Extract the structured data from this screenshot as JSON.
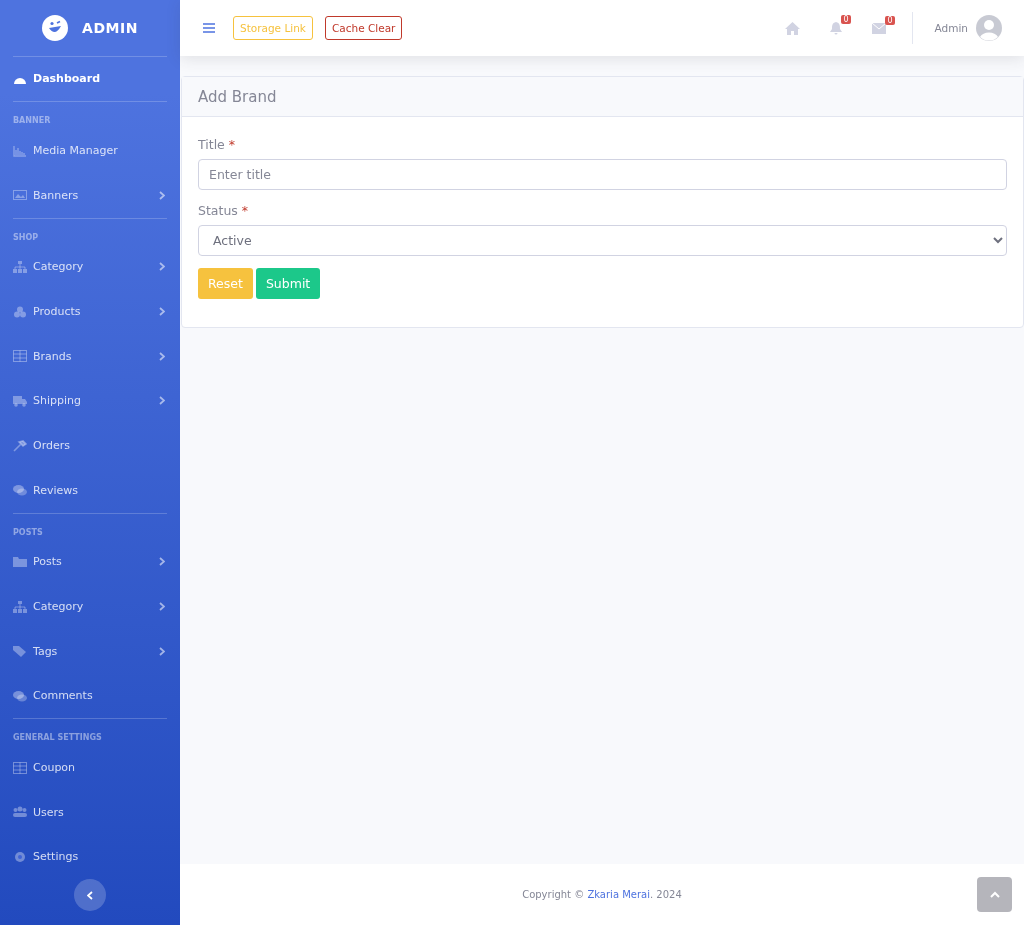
{
  "brand": {
    "title": "ADMIN"
  },
  "sidebar": {
    "sections": [
      {
        "items": [
          {
            "label": "Dashboard",
            "selected": true,
            "expandable": false
          }
        ]
      },
      {
        "heading": "BANNER",
        "items": [
          {
            "label": "Media Manager",
            "selected": false,
            "expandable": false
          },
          {
            "label": "Banners",
            "selected": false,
            "expandable": true
          }
        ]
      },
      {
        "heading": "SHOP",
        "items": [
          {
            "label": "Category",
            "selected": false,
            "expandable": true
          },
          {
            "label": "Products",
            "selected": false,
            "expandable": true
          },
          {
            "label": "Brands",
            "selected": false,
            "expandable": true
          },
          {
            "label": "Shipping",
            "selected": false,
            "expandable": true
          },
          {
            "label": "Orders",
            "selected": false,
            "expandable": false
          },
          {
            "label": "Reviews",
            "selected": false,
            "expandable": false
          }
        ]
      },
      {
        "heading": "POSTS",
        "items": [
          {
            "label": "Posts",
            "selected": false,
            "expandable": true
          },
          {
            "label": "Category",
            "selected": false,
            "expandable": true
          },
          {
            "label": "Tags",
            "selected": false,
            "expandable": true
          },
          {
            "label": "Comments",
            "selected": false,
            "expandable": false
          }
        ]
      },
      {
        "heading": "GENERAL SETTINGS",
        "items": [
          {
            "label": "Coupon",
            "selected": false,
            "expandable": false
          },
          {
            "label": "Users",
            "selected": false,
            "expandable": false
          },
          {
            "label": "Settings",
            "selected": false,
            "expandable": false
          }
        ]
      }
    ]
  },
  "topbar": {
    "buttons": [
      {
        "label": "Storage Link",
        "kind": "warning"
      },
      {
        "label": "Cache Clear",
        "kind": "danger"
      }
    ],
    "alerts_count": "0",
    "messages_count": "0",
    "user_name": "Admin"
  },
  "card": {
    "title": "Add Brand",
    "fields": [
      {
        "label": "Title",
        "required_mark": "*",
        "kind": "text",
        "placeholder": "Enter title"
      },
      {
        "label": "Status",
        "required_mark": "*",
        "kind": "select",
        "value": "Active"
      }
    ],
    "buttons": [
      {
        "label": "Reset",
        "kind": "warning"
      },
      {
        "label": "Submit",
        "kind": "success"
      }
    ]
  },
  "footer": {
    "prefix": "Copyright ©",
    "link": "Zkaria Merai",
    "suffix": ". 2024"
  }
}
